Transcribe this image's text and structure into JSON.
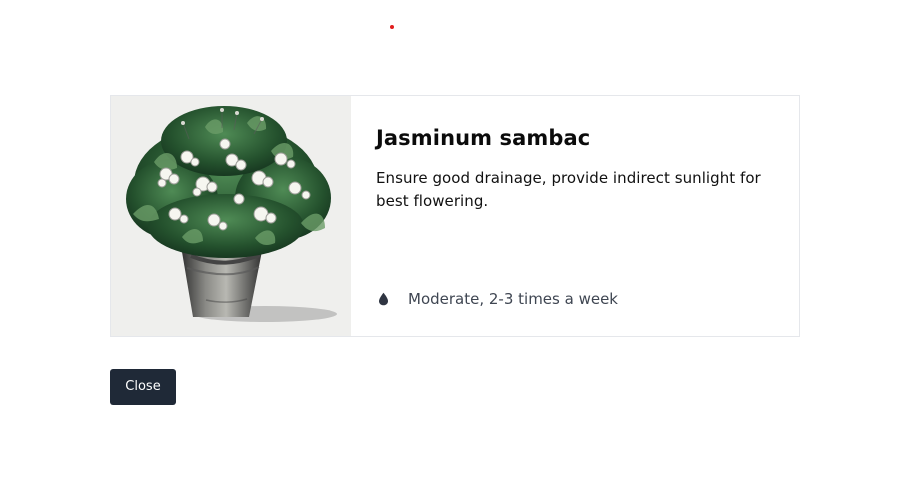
{
  "plant": {
    "name": "Jasminum sambac",
    "care_instructions": "Ensure good drainage, provide indirect sunlight for best flowering.",
    "watering": "Moderate, 2-3 times a week",
    "image_icon": "jasmine-potted-plant-image",
    "water_icon": "water-drop-icon"
  },
  "actions": {
    "close_label": "Close"
  },
  "colors": {
    "button_background": "#1f2937",
    "button_text": "#ffffff",
    "title_text": "#0b0b0b",
    "meta_text": "#3f4652",
    "border": "#e5e7eb",
    "accent_dot": "#e11d1d"
  }
}
